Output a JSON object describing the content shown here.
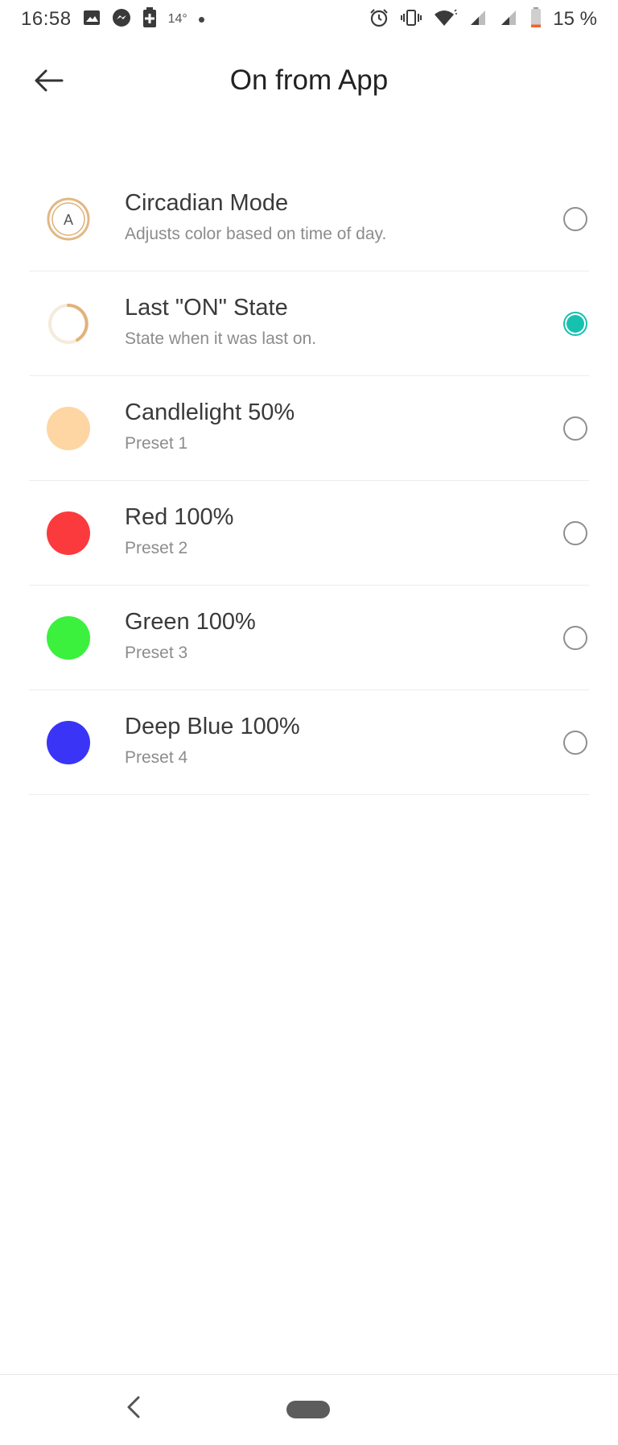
{
  "status_bar": {
    "time": "16:58",
    "temperature": "14°",
    "battery_percent": "15 %",
    "left_icons": [
      "gallery-icon",
      "messenger-icon",
      "battery-saver-icon"
    ],
    "right_icons": [
      "alarm-icon",
      "vibrate-icon",
      "wifi-icon",
      "signal-icon",
      "signal-icon",
      "battery-low-icon"
    ],
    "battery_level": 0.15
  },
  "app_bar": {
    "back_icon": "arrow-left-icon",
    "title": "On from App"
  },
  "accent_color": "#17c1b0",
  "options": [
    {
      "title": "Circadian Mode",
      "subtitle": "Adjusts color based on time of day.",
      "icon": "circadian-a-icon",
      "color": "#d9a866",
      "selected": false
    },
    {
      "title": "Last \"ON\" State",
      "subtitle": "State when it was last on.",
      "icon": "last-state-ring-icon",
      "color": "#e3b27a",
      "selected": true
    },
    {
      "title": "Candlelight 50%",
      "subtitle": "Preset 1",
      "icon": "color-swatch",
      "color": "#fdd6a4",
      "selected": false
    },
    {
      "title": "Red 100%",
      "subtitle": "Preset 2",
      "icon": "color-swatch",
      "color": "#fb3a3d",
      "selected": false
    },
    {
      "title": "Green 100%",
      "subtitle": "Preset 3",
      "icon": "color-swatch",
      "color": "#3cf03e",
      "selected": false
    },
    {
      "title": "Deep Blue 100%",
      "subtitle": "Preset 4",
      "icon": "color-swatch",
      "color": "#3a35f6",
      "selected": false
    }
  ],
  "nav_bar": {
    "back_icon": "chevron-left-icon",
    "home_icon": "home-pill-icon"
  }
}
